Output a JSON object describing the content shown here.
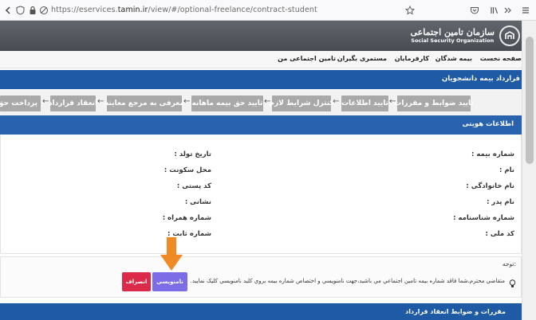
{
  "browser": {
    "url_prefix": "https://eservices.",
    "url_domain": "tamin.ir",
    "url_path": "/view/#/optional-freelance/contract-student"
  },
  "header": {
    "logo_fa": "سازمان تامین اجتماعی",
    "logo_en": "Social Security Organization"
  },
  "nav": {
    "home": "صفحه نخست",
    "insured": "بیمه شدگان",
    "employers": "کارفرمایان",
    "pensioners": "مستمری بگیران",
    "my_social_security": "تامین اجتماعی من"
  },
  "page_title": "قرارداد بیمه دانشجویان",
  "steps": [
    "تایید ضوابط و مقررات",
    "تایید اطلاعات",
    "کنترل شرایط لازم",
    "تایید حق بیمه ماهانه",
    "معرفی به مرجع معاینه",
    "انعقاد قرارداد",
    "پرداخت حق"
  ],
  "step_arrow": "←",
  "identity": {
    "title": "اطلاعات هویتی",
    "right_labels": [
      "شماره بیمه :",
      "نام :",
      "نام خانوادگی :",
      "نام پدر :",
      "شماره شناسنامه :",
      "کد ملی :"
    ],
    "middle_labels": [
      "تاریخ تولد :",
      "محل سکونت :",
      "کد پستی :",
      "نشانی :",
      "شماره همراه :",
      "شماره ثابت :"
    ]
  },
  "notice": {
    "title": "توجه:",
    "text": "متقاضي محترم،شما فاقد شماره بيمه تامين اجتماعي مي باشيد،جهت نامنويسي و اختصاص شماره بيمه بروي كليد نامنويسي كليک نماييد.",
    "register_label": "نامنويسي",
    "cancel_label": "انصراف"
  },
  "bottom_title": "مقررات و ضوابط انعقاد قرارداد",
  "colors": {
    "primary_blue": "#1f5ba4",
    "register_purple": "#7b6de6",
    "cancel_red": "#dc2b4a",
    "pointer_orange": "#f08a24"
  }
}
